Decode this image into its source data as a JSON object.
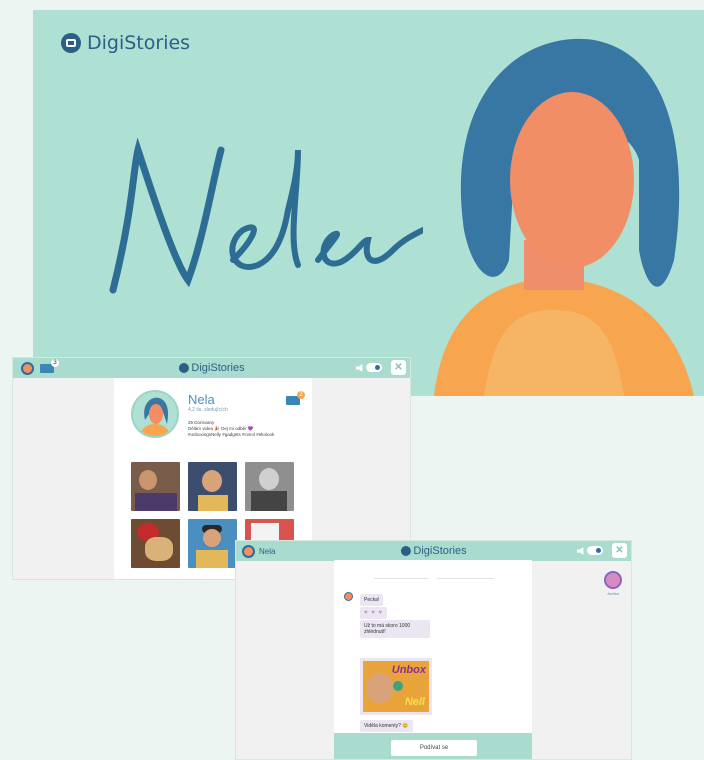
{
  "hero": {
    "brand": "DigiStories",
    "script_title": "Nela"
  },
  "profile_window": {
    "brand": "DigiStories",
    "mail_badge": "3",
    "profile": {
      "name": "Nela",
      "age": "4,2 tis. sledujících",
      "bio_line1": "25 Dorisvany",
      "bio_line2": "Dělám videa 🎉 Dej mi odběr 💜",
      "bio_line3": "#unboxingsNelly #gadgets #cvirol #ekolook",
      "mail_badge": "2"
    },
    "thumbnails": [
      {
        "label": "photo-1"
      },
      {
        "label": "photo-2"
      },
      {
        "label": "photo-3"
      },
      {
        "label": "photo-4"
      },
      {
        "label": "photo-5"
      },
      {
        "label": "photo-6"
      }
    ]
  },
  "chat_window": {
    "contact_name": "Nela",
    "brand": "DigiStories",
    "messages": [
      {
        "text": "Pecka!"
      },
      {
        "text": "♥ ♥ ♥"
      },
      {
        "text": "Už to má skoro 1000 zhlédnutí!"
      },
      {
        "text": "Viděla komenty? 😊"
      }
    ],
    "media_title_1": "Unbox",
    "media_title_2": "Nell",
    "watch_button": "Podívat se",
    "friend_name": "Andka"
  }
}
